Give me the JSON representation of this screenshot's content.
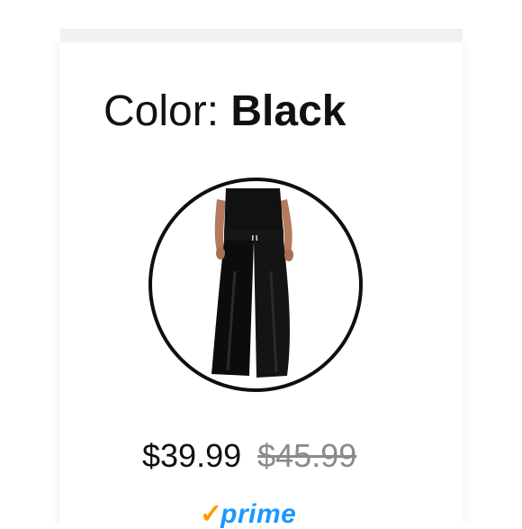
{
  "product": {
    "color_label": "Color:",
    "color_value": "Black",
    "swatch_icon": "black-jumpsuit-thumbnail",
    "price_current": "$39.99",
    "price_original": "$45.99",
    "prime_check": "✓",
    "prime_label": "prime"
  },
  "colors": {
    "prime_check": "#ff9900",
    "prime_text": "#1a98ff",
    "swatch_border": "#0f0f0f",
    "original_price": "#8a8a8a"
  }
}
